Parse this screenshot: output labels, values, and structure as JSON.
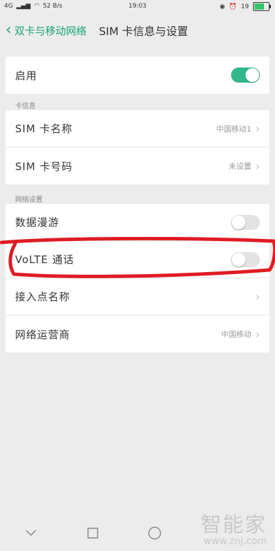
{
  "status_bar": {
    "network": "4G",
    "speed": "52 B/s",
    "time": "19:03",
    "battery": "19"
  },
  "header": {
    "back_label": "双卡与移动网络",
    "title": "SIM 卡信息与设置"
  },
  "enable": {
    "label": "启用",
    "state": "on"
  },
  "card_info": {
    "section_label": "卡信息",
    "rows": [
      {
        "label": "SIM 卡名称",
        "value": "中国移动1"
      },
      {
        "label": "SIM 卡号码",
        "value": "未设置"
      }
    ]
  },
  "network_settings": {
    "section_label": "网络设置",
    "rows": [
      {
        "label": "数据漫游",
        "state": "off"
      },
      {
        "label": "VoLTE 通话",
        "state": "off"
      },
      {
        "label": "接入点名称",
        "value": ""
      },
      {
        "label": "网络运营商",
        "value": "中国移动"
      }
    ]
  },
  "watermark": {
    "brand": "智能家",
    "url": "www.znj.com"
  },
  "colors": {
    "accent": "#31b88a",
    "annotation": "#e01b24"
  }
}
